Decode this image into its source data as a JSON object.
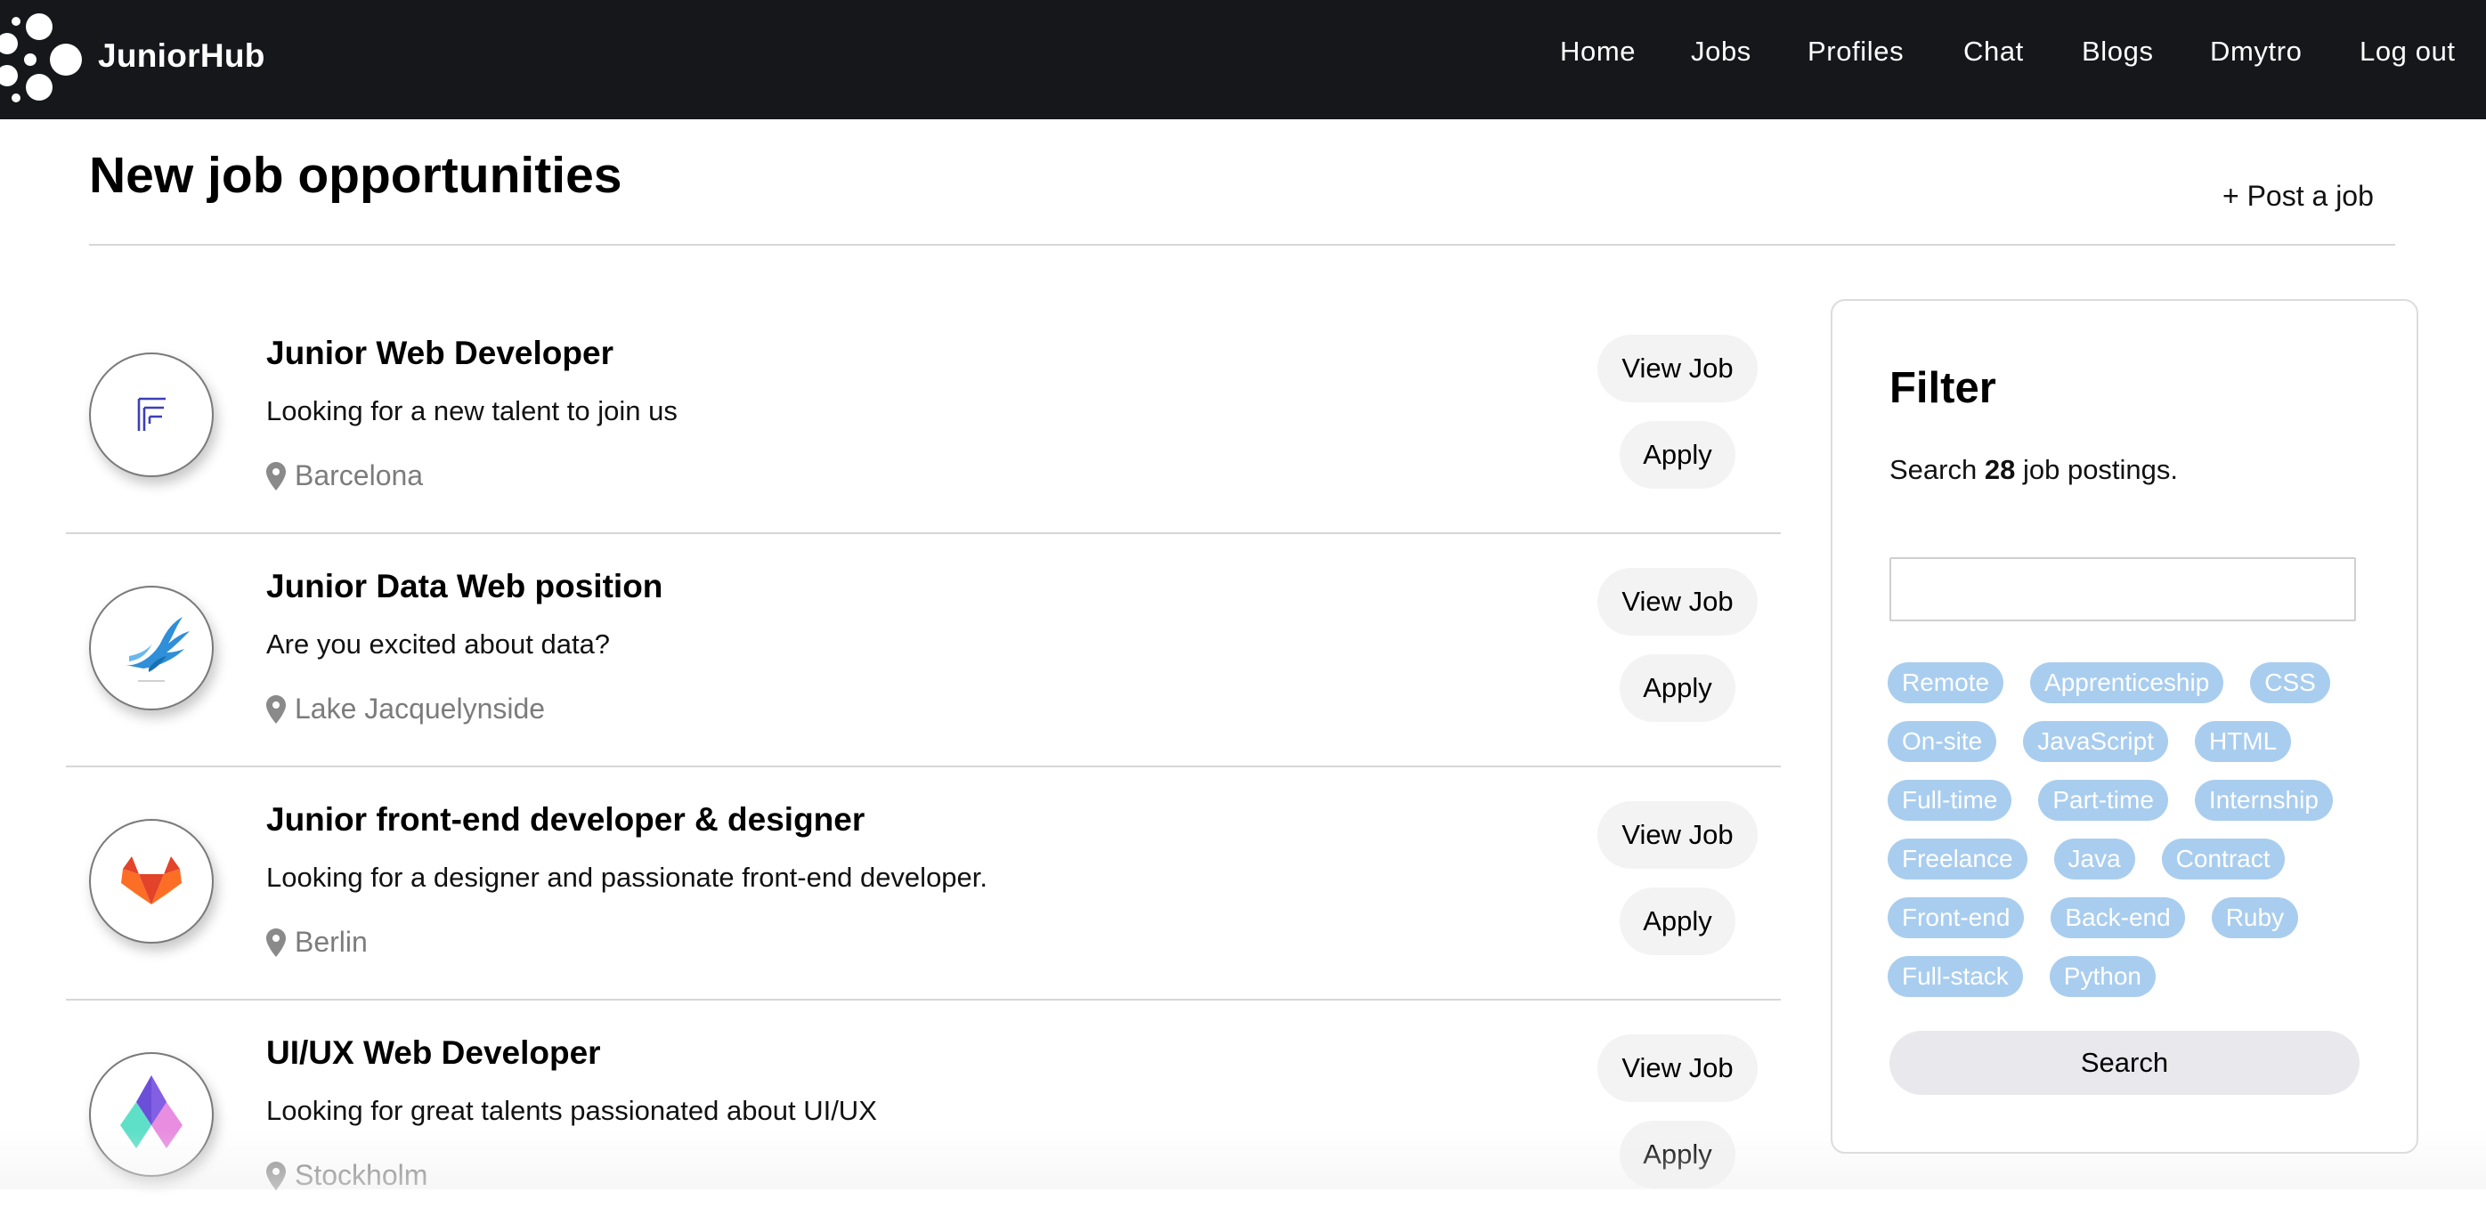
{
  "nav": {
    "brand": "JuniorHub",
    "links": [
      "Home",
      "Jobs",
      "Profiles",
      "Chat",
      "Blogs",
      "Dmytro",
      "Log out"
    ]
  },
  "header": {
    "title": "New job opportunities",
    "post_job": "+ Post a job"
  },
  "jobs": [
    {
      "title": "Junior Web Developer",
      "description": "Looking for a new talent to join us",
      "location": "Barcelona",
      "logo": "letter-f-logo-icon",
      "view_label": "View Job",
      "apply_label": "Apply"
    },
    {
      "title": "Junior Data Web position",
      "description": "Are you excited about data?",
      "location": "Lake Jacquelynside",
      "logo": "blue-bird-logo-icon",
      "view_label": "View Job",
      "apply_label": "Apply"
    },
    {
      "title": "Junior front-end developer & designer",
      "description": "Looking for a designer and passionate front-end developer.",
      "location": "Berlin",
      "logo": "fox-logo-icon",
      "view_label": "View Job",
      "apply_label": "Apply"
    },
    {
      "title": "UI/UX Web Developer",
      "description": "Looking for great talents passionated about UI/UX",
      "location": "Stockholm",
      "logo": "diamond-logo-icon",
      "view_label": "View Job",
      "apply_label": "Apply"
    }
  ],
  "filter": {
    "title": "Filter",
    "count_prefix": "Search",
    "count": "28",
    "count_suffix": "job postings.",
    "search_value": "",
    "search_placeholder": "",
    "tags": [
      "Remote",
      "Apprenticeship",
      "CSS",
      "On-site",
      "JavaScript",
      "HTML",
      "Full-time",
      "Part-time",
      "Internship",
      "Freelance",
      "Java",
      "Contract",
      "Front-end",
      "Back-end",
      "Ruby",
      "Full-stack",
      "Python"
    ],
    "search_button": "Search"
  },
  "colors": {
    "nav_bg": "#15171b",
    "tag_bg": "#a9cdee",
    "button_bg": "#f3f3f3",
    "location_text": "#7c7c7c"
  }
}
